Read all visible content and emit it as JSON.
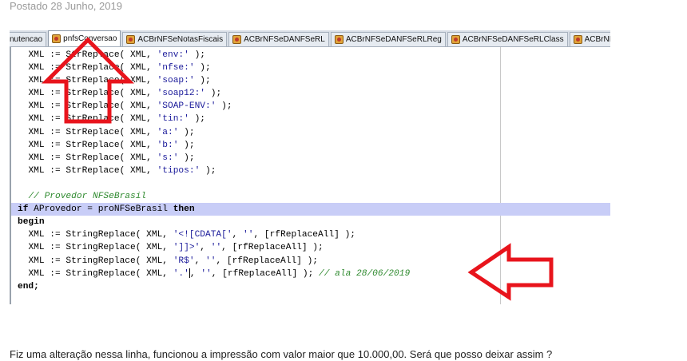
{
  "post": {
    "date": "Postado 28 Junho, 2019"
  },
  "tabs": [
    {
      "label": "nutencao",
      "active": false
    },
    {
      "label": "pnfsConversao",
      "active": true
    },
    {
      "label": "ACBrNFSeNotasFiscais",
      "active": false
    },
    {
      "label": "ACBrNFSeDANFSeRL",
      "active": false
    },
    {
      "label": "ACBrNFSeDANFSeRLReg",
      "active": false
    },
    {
      "label": "ACBrNFSeDANFSeRLClass",
      "active": false
    },
    {
      "label": "ACBrNFSeD",
      "active": false
    }
  ],
  "code": {
    "lines": [
      {
        "indent": "",
        "a": "XML := StrReplace( XML, ",
        "s": "'env:'",
        "b": " );"
      },
      {
        "indent": "",
        "a": "XML := StrReplace( XML, ",
        "s": "'nfse:'",
        "b": " );"
      },
      {
        "indent": "",
        "a": "XML := StrReplace( XML, ",
        "s": "'soap:'",
        "b": " );"
      },
      {
        "indent": "",
        "a": "XML := StrReplace( XML, ",
        "s": "'soap12:'",
        "b": " );"
      },
      {
        "indent": "",
        "a": "XML := StrReplace( XML, ",
        "s": "'SOAP-ENV:'",
        "b": " );"
      },
      {
        "indent": "",
        "a": "XML := StrReplace( XML, ",
        "s": "'tin:'",
        "b": " );"
      },
      {
        "indent": "",
        "a": "XML := StrReplace( XML, ",
        "s": "'a:'",
        "b": " );"
      },
      {
        "indent": "",
        "a": "XML := StrReplace( XML, ",
        "s": "'b:'",
        "b": " );"
      },
      {
        "indent": "",
        "a": "XML := StrReplace( XML, ",
        "s": "'s:'",
        "b": " );"
      },
      {
        "indent": "",
        "a": "XML := StrReplace( XML, ",
        "s": "'tipos:'",
        "b": " );"
      }
    ],
    "comment_provider": "// Provedor NFSeBrasil",
    "if_kw": "if",
    "if_cond": " AProvedor = proNFSeBrasil ",
    "then_kw": "then",
    "begin_kw": "begin",
    "replace_lines": [
      {
        "a": "XML := StringReplace( XML, ",
        "s1": "'<![CDATA['",
        "m": ", ",
        "s2": "''",
        "b": ", [rfReplaceAll] );"
      },
      {
        "a": "XML := StringReplace( XML, ",
        "s1": "']]>'",
        "m": ", ",
        "s2": "''",
        "b": ", [rfReplaceAll] );"
      },
      {
        "a": "XML := StringReplace( XML, ",
        "s1": "'R$'",
        "m": ", ",
        "s2": "''",
        "b": ", [rfReplaceAll] );"
      }
    ],
    "last_line": {
      "a": "XML := StringReplace( XML, ",
      "s1": "'.'",
      "m": ", ",
      "s2": "''",
      "b": ", [rfReplaceAll] ); ",
      "comment": "// ala 28/06/2019"
    },
    "end_kw": "end;"
  },
  "message": "Fiz uma alteração nessa linha, funcionou a impressão com valor maior que 10.000,00. Será que posso deixar assim ?",
  "colors": {
    "arrow": "#e8141c",
    "highlight": "#c8cdf7",
    "comment": "#2f8a2f",
    "string": "#1a1a9a"
  }
}
